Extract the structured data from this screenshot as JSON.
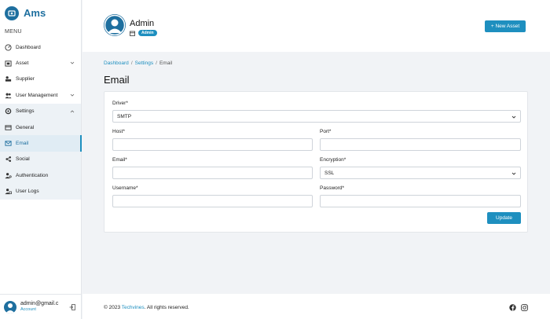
{
  "app": {
    "name": "Ams",
    "accent": "#1e8fbf",
    "brand": "#1e6f9f"
  },
  "sidebar": {
    "menu_label": "MENU",
    "items": [
      {
        "label": "Dashboard",
        "icon": "dashboard-icon"
      },
      {
        "label": "Asset",
        "icon": "asset-icon"
      },
      {
        "label": "Supplier",
        "icon": "supplier-icon"
      },
      {
        "label": "User Management",
        "icon": "users-icon"
      },
      {
        "label": "Settings",
        "icon": "gear-icon"
      },
      {
        "label": "General",
        "icon": "general-icon"
      },
      {
        "label": "Email",
        "icon": "email-icon"
      },
      {
        "label": "Social",
        "icon": "social-icon"
      },
      {
        "label": "Authentication",
        "icon": "authentication-icon"
      },
      {
        "label": "User Logs",
        "icon": "user-logs-icon"
      }
    ],
    "active": "Email",
    "footer": {
      "email": "admin@gmail.c",
      "account_label": "Account"
    }
  },
  "header": {
    "user_name": "Admin",
    "role_badge": "Admin",
    "new_asset_label": "+ New Asset"
  },
  "breadcrumb": {
    "items": [
      "Dashboard",
      "Settings",
      "Email"
    ]
  },
  "page": {
    "title": "Email"
  },
  "form": {
    "driver": {
      "label": "Driver*",
      "value": "SMTP"
    },
    "host": {
      "label": "Host*",
      "value": ""
    },
    "port": {
      "label": "Port*",
      "value": ""
    },
    "email": {
      "label": "Email*",
      "value": ""
    },
    "encryption": {
      "label": "Encryption*",
      "value": "SSL"
    },
    "username": {
      "label": "Username*",
      "value": ""
    },
    "password": {
      "label": "Password*",
      "value": ""
    },
    "update_label": "Update"
  },
  "footer": {
    "prefix": "© 2023 ",
    "link": "Techvines",
    "suffix": ". All rights reserved.",
    "icons": [
      "facebook-icon",
      "instagram-icon"
    ]
  }
}
